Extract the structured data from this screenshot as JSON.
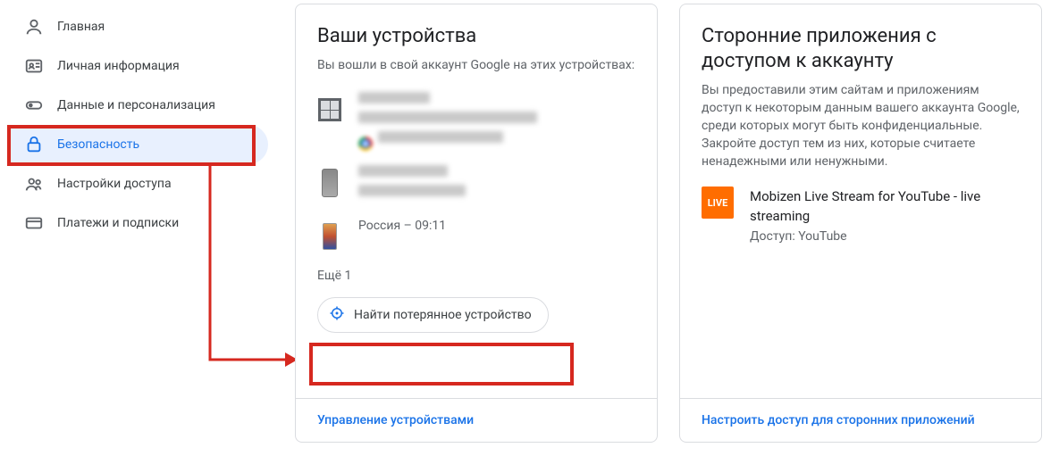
{
  "sidebar": {
    "items": [
      {
        "label": "Главная"
      },
      {
        "label": "Личная информация"
      },
      {
        "label": "Данные и персонализация"
      },
      {
        "label": "Безопасность"
      },
      {
        "label": "Настройки доступа"
      },
      {
        "label": "Платежи и подписки"
      }
    ]
  },
  "devices_card": {
    "title": "Ваши устройства",
    "description": "Вы вошли в свой аккаунт Google на этих устройствах:",
    "devices": [
      {
        "last_activity": ""
      },
      {
        "last_activity": ""
      },
      {
        "last_activity": "Россия – 09:11"
      }
    ],
    "more_label": "Ещё 1",
    "find_button_label": "Найти потерянное устройство",
    "footer_link": "Управление устройствами"
  },
  "apps_card": {
    "title": "Сторонние приложения с доступом к аккаунту",
    "description": "Вы предоставили этим сайтам и приложениям доступ к некоторым данным вашего аккаунта Google, среди которых могут быть конфиденциальные. Закройте доступ тем из них, которые считаете ненадежными или ненужными.",
    "apps": [
      {
        "badge": "LIVE",
        "name": "Mobizen Live Stream for YouTube - live streaming",
        "access": "Доступ: YouTube"
      }
    ],
    "footer_link": "Настроить доступ для сторонних приложений"
  }
}
